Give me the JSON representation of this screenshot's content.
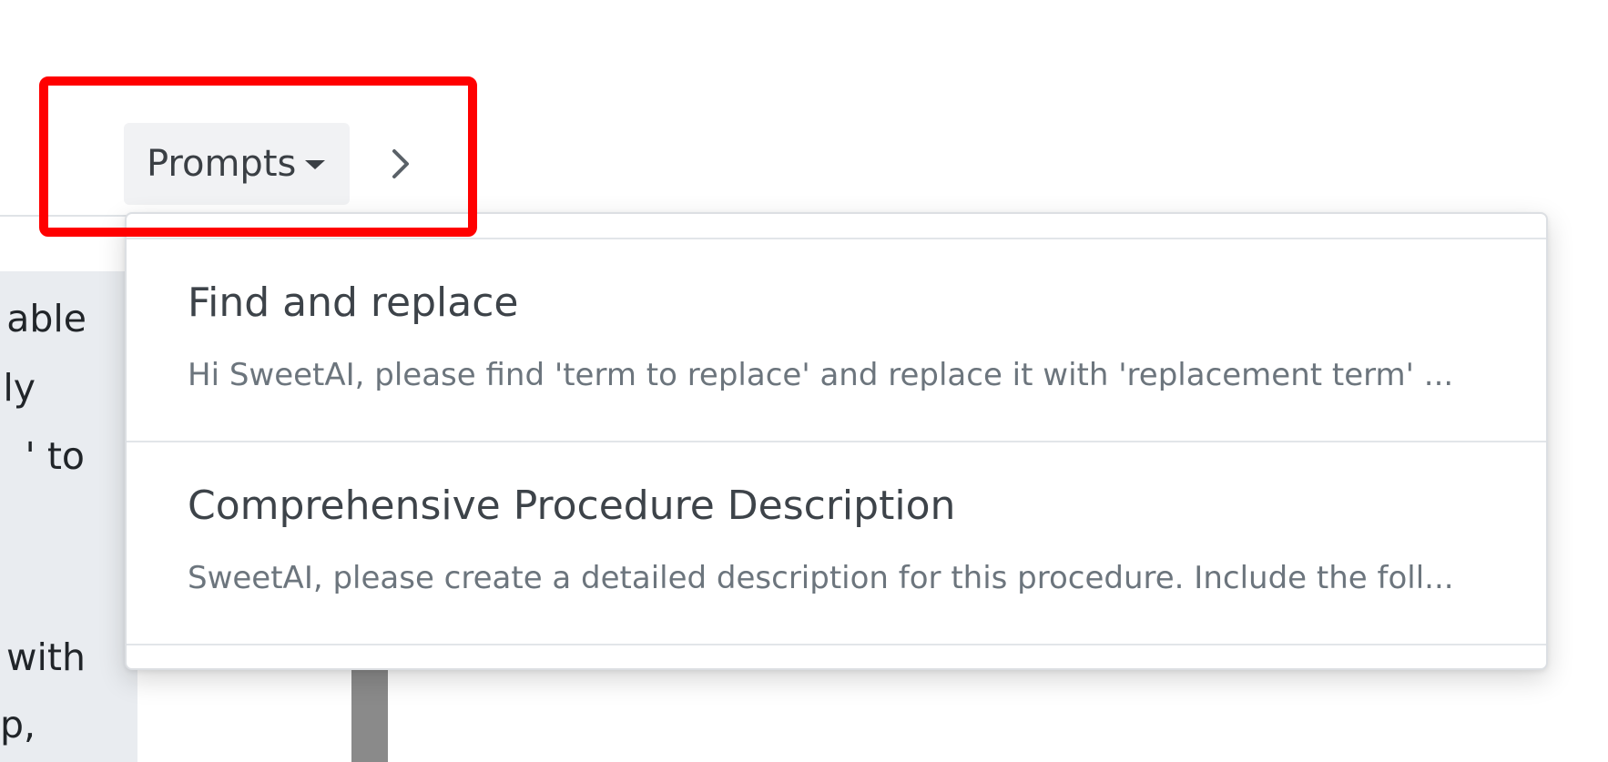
{
  "toolbar": {
    "prompts_label": "Prompts"
  },
  "chat": {
    "fragments": [
      "able",
      "ly",
      "' to",
      "with",
      "p,"
    ]
  },
  "prompts_menu": {
    "items": [
      {
        "title": "Find and replace",
        "description": "Hi SweetAI, please find 'term to replace' and replace it with 'replacement term' ..."
      },
      {
        "title": "Comprehensive Procedure Description",
        "description": "SweetAI, please create a detailed description for this procedure. Include the foll..."
      }
    ]
  },
  "colors": {
    "highlight": "#ff0000",
    "button_bg": "#f1f2f4",
    "bubble_bg": "#e9ecf0"
  },
  "icons": {
    "dropdown": "caret-down-icon",
    "next": "chevron-right-icon"
  }
}
